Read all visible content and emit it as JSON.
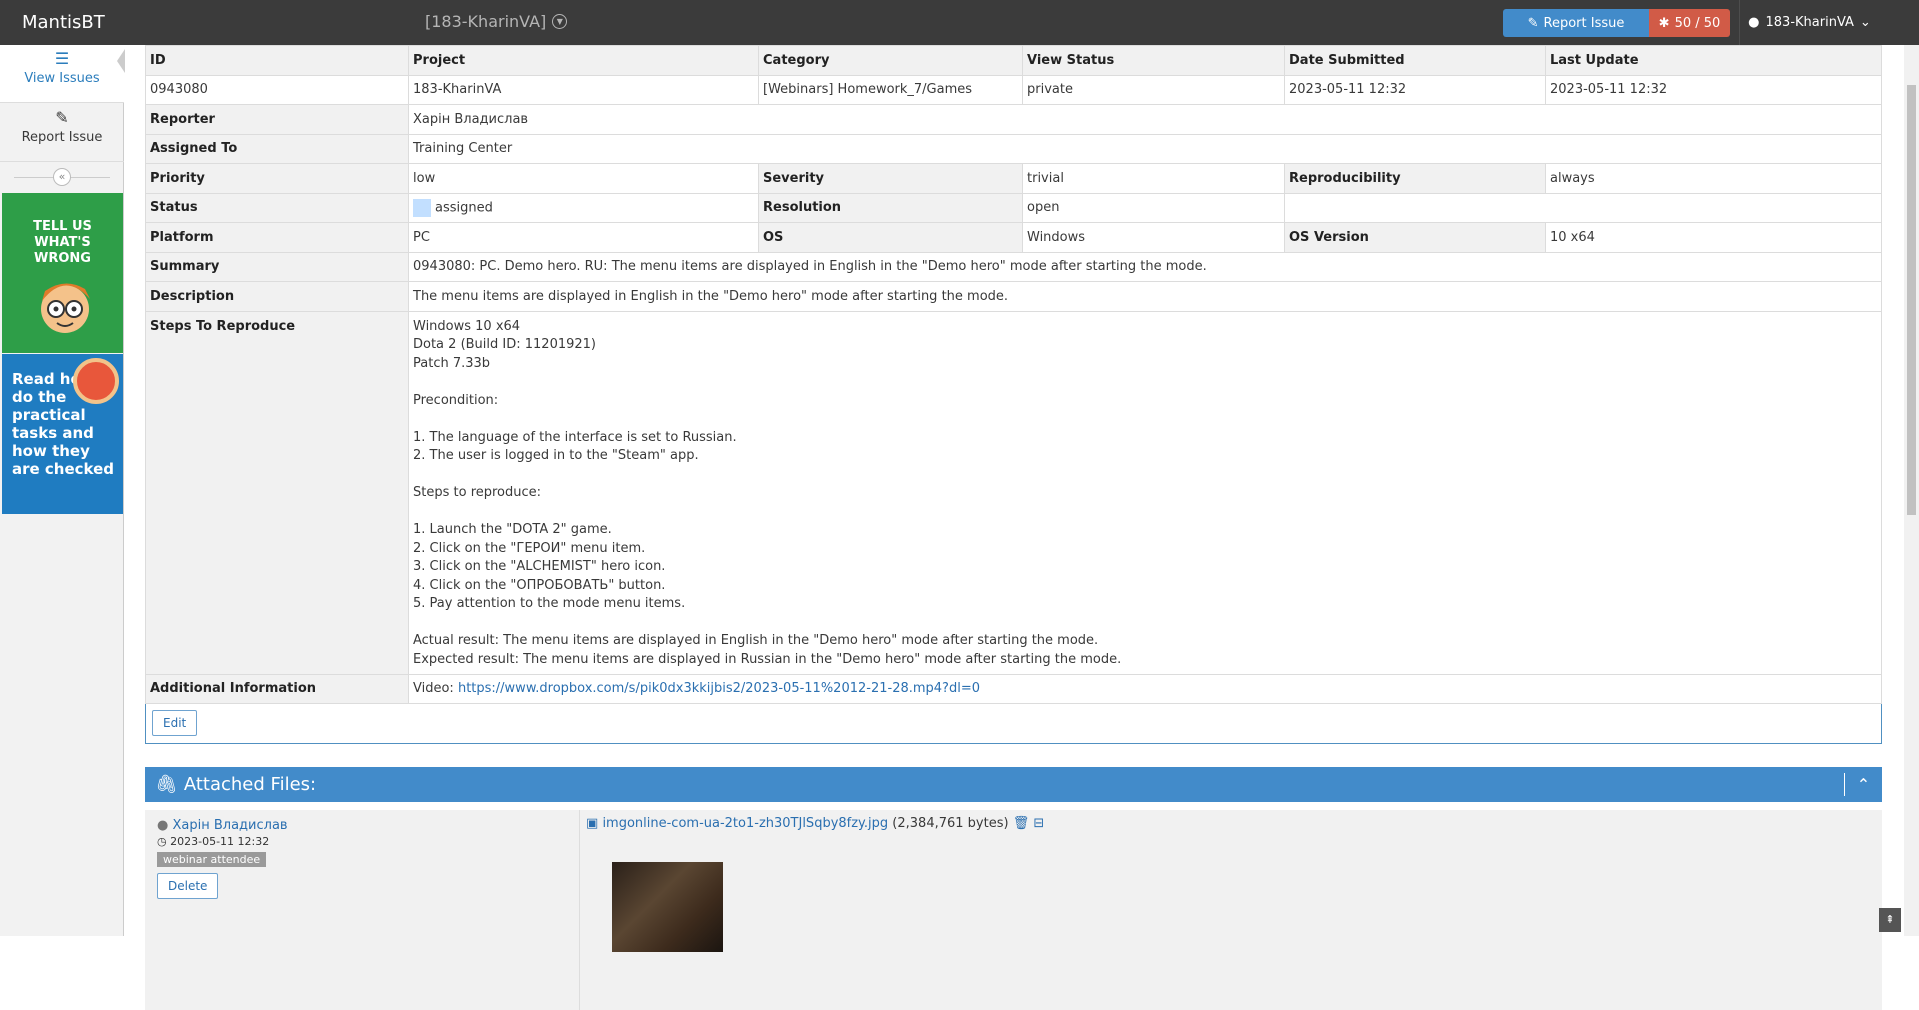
{
  "navbar": {
    "brand": "MantisBT",
    "project": "[183-KharinVA]",
    "report_issue": "Report Issue",
    "issue_count": "50 / 50",
    "user": "183-KharinVA"
  },
  "sidebar": {
    "items": [
      {
        "label": "View Issues"
      },
      {
        "label": "Report Issue"
      }
    ],
    "ad_top": "TELL US WHAT'S WRONG",
    "ad_bottom": "Read how to do the practical tasks and how they are checked"
  },
  "issue": {
    "headers": [
      "ID",
      "Project",
      "Category",
      "View Status",
      "Date Submitted",
      "Last Update"
    ],
    "values": [
      "0943080",
      "183-KharinVA",
      "[Webinars] Homework_7/Games",
      "private",
      "2023-05-11 12:32",
      "2023-05-11 12:32"
    ],
    "reporter_label": "Reporter",
    "reporter": "Харін Владислав",
    "assigned_label": "Assigned To",
    "assigned": "Training Center",
    "priority_label": "Priority",
    "priority": "low",
    "severity_label": "Severity",
    "severity": "trivial",
    "reproducibility_label": "Reproducibility",
    "reproducibility": "always",
    "status_label": "Status",
    "status": "assigned",
    "resolution_label": "Resolution",
    "resolution": "open",
    "platform_label": "Platform",
    "platform": "PC",
    "os_label": "OS",
    "os": "Windows",
    "os_version_label": "OS Version",
    "os_version": "10 x64",
    "summary_label": "Summary",
    "summary": "0943080: PC. Demo hero. RU: The menu items are displayed in English in the \"Demo hero\" mode after starting the mode.",
    "description_label": "Description",
    "description": "The menu items are displayed in English in the \"Demo hero\" mode after starting the mode.",
    "steps_label": "Steps To Reproduce",
    "steps": "Windows 10 x64\nDota 2 (Build ID: 11201921)\nPatch 7.33b\n\nPrecondition:\n\n1. The language of the interface is set to Russian.\n2. The user is logged in to the \"Steam\" app.\n\nSteps to reproduce:\n\n1. Launch the \"DOTA 2\" game.\n2. Click on the \"ГЕРОИ\" menu item.\n3. Click on the \"ALCHEMIST\" hero icon.\n4. Click on the \"ОПРОБОВАТЬ\" button.\n5. Pay attention to the mode menu items.\n\nActual result: The menu items are displayed in English in the \"Demo hero\" mode after starting the mode.\nExpected result: The menu items are displayed in Russian in the \"Demo hero\" mode after starting the mode.",
    "additional_label": "Additional Information",
    "additional_prefix": "Video:",
    "additional_link": "https://www.dropbox.com/s/pik0dx3kkijbis2/2023-05-11%2012-21-28.mp4?dl=0",
    "edit": "Edit"
  },
  "attachments": {
    "title": "Attached Files:",
    "user": "Харін Владислав",
    "date": "2023-05-11 12:32",
    "tag": "webinar attendee",
    "delete": "Delete",
    "file": "imgonline-com-ua-2to1-zh30TJlSqby8fzy.jpg",
    "size": "(2,384,761 bytes)"
  },
  "colors": {
    "navbar": "#3b3b3b",
    "accent": "#428bca",
    "danger": "#d15b47"
  }
}
